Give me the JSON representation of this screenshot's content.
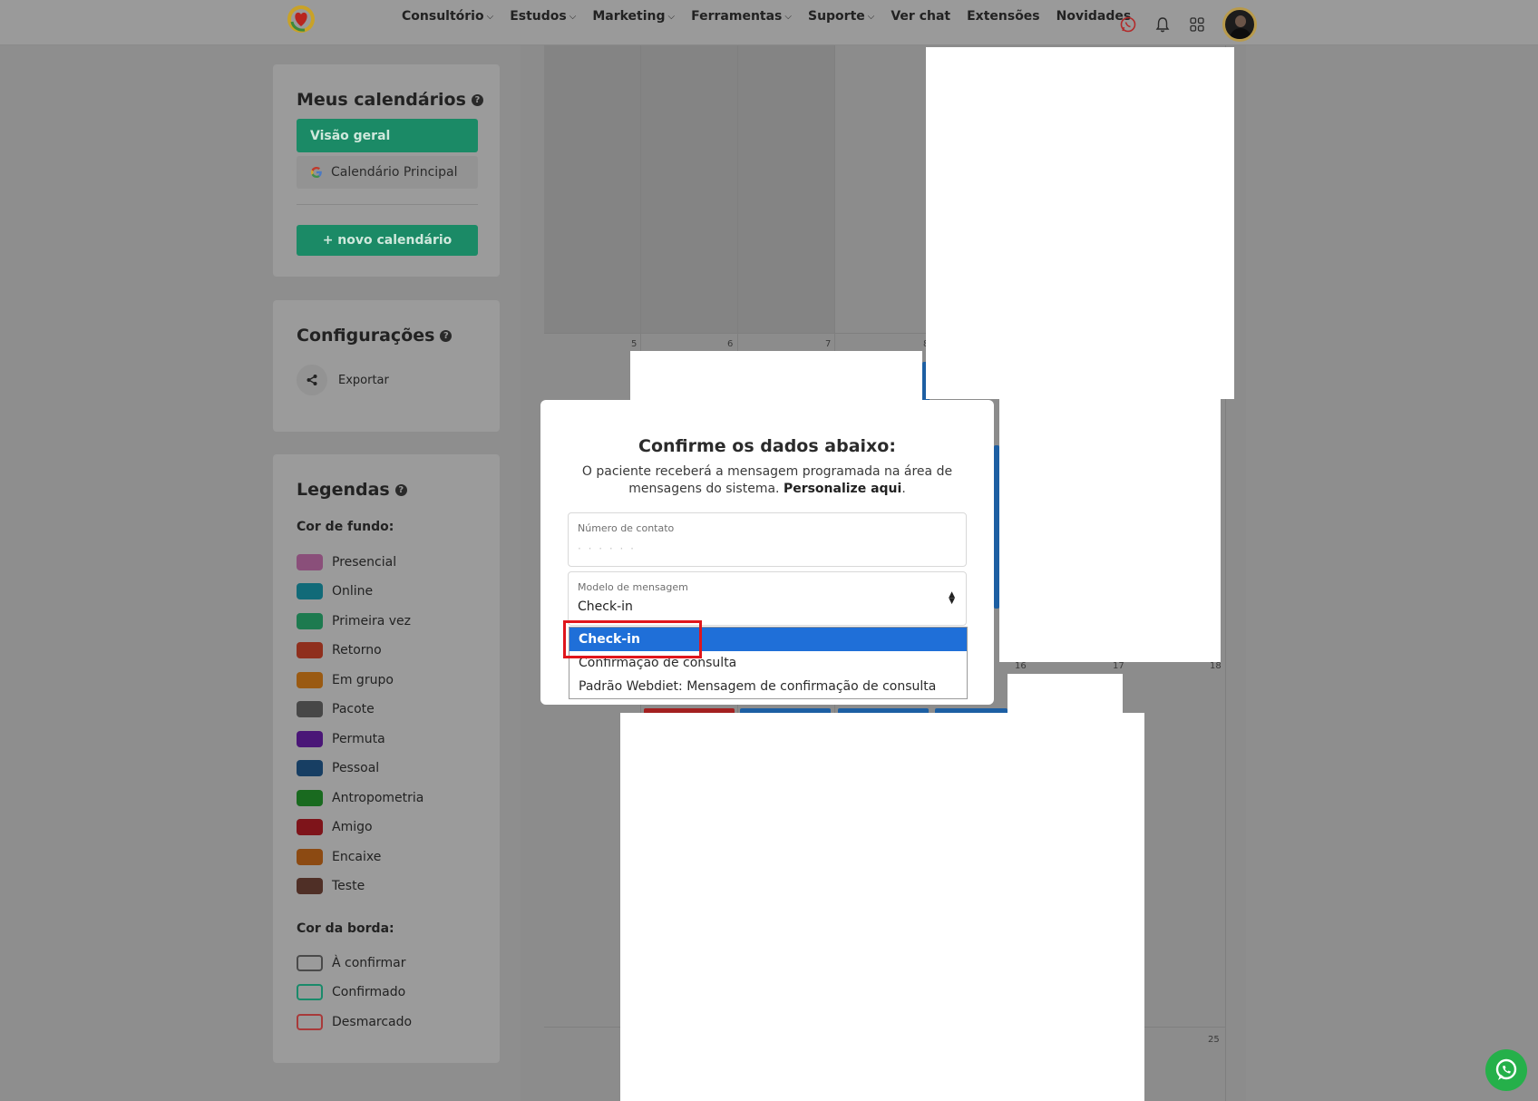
{
  "nav": {
    "items": [
      {
        "label": "Consultório",
        "dropdown": true
      },
      {
        "label": "Estudos",
        "dropdown": true
      },
      {
        "label": "Marketing",
        "dropdown": true
      },
      {
        "label": "Ferramentas",
        "dropdown": true
      },
      {
        "label": "Suporte",
        "dropdown": true
      },
      {
        "label": "Ver chat",
        "dropdown": false
      },
      {
        "label": "Extensões",
        "dropdown": false
      },
      {
        "label": "Novidades",
        "dropdown": false
      }
    ],
    "icons": [
      "whatsapp-icon",
      "bell-icon",
      "apps-grid-icon",
      "avatar"
    ]
  },
  "calendars": {
    "title": "Meus calendários",
    "overview_label": "Visão geral",
    "main_calendar_label": "Calendário Principal",
    "new_calendar_label": "+ novo calendário"
  },
  "settings": {
    "title": "Configurações",
    "export_label": "Exportar"
  },
  "legend": {
    "title": "Legendas",
    "background_title": "Cor de fundo:",
    "background_items": [
      {
        "label": "Presencial",
        "color": "#8a4f7a"
      },
      {
        "label": "Online",
        "color": "#116a78"
      },
      {
        "label": "Primeira vez",
        "color": "#1d7a4f"
      },
      {
        "label": "Retorno",
        "color": "#8f2f1d"
      },
      {
        "label": "Em grupo",
        "color": "#9a5a12"
      },
      {
        "label": "Pacote",
        "color": "#474747"
      },
      {
        "label": "Permuta",
        "color": "#4a1677"
      },
      {
        "label": "Pessoal",
        "color": "#173e63"
      },
      {
        "label": "Antropometria",
        "color": "#196a1f"
      },
      {
        "label": "Amigo",
        "color": "#7e141a"
      },
      {
        "label": "Encaixe",
        "color": "#8c4a12"
      },
      {
        "label": "Teste",
        "color": "#4f2f26"
      }
    ],
    "border_title": "Cor da borda:",
    "border_items": [
      {
        "label": "À confirmar",
        "color": "#4a4a4a"
      },
      {
        "label": "Confirmado",
        "color": "#1a8a6a"
      },
      {
        "label": "Desmarcado",
        "color": "#a83a3a"
      }
    ]
  },
  "calendar_days": [
    "5",
    "6",
    "7",
    "8",
    "16",
    "17",
    "18",
    "25"
  ],
  "modal": {
    "title": "Confirme os dados abaixo:",
    "description_prefix": "O paciente receberá a mensagem programada na área de mensagens do sistema.",
    "description_link": "Personalize aqui",
    "description_suffix": ".",
    "contact_label": "Número de contato",
    "contact_value": "· · · · · ·",
    "template_label": "Modelo de mensagem",
    "template_value": "Check-in",
    "options": [
      "Check-in",
      "Confirmação de consulta",
      "Padrão Webdiet: Mensagem de confirmação de consulta"
    ],
    "selected_index": 0
  },
  "colors": {
    "accent_green": "#1b8a66",
    "selected_blue": "#1f6fd8",
    "highlight_red": "#e0161c"
  }
}
